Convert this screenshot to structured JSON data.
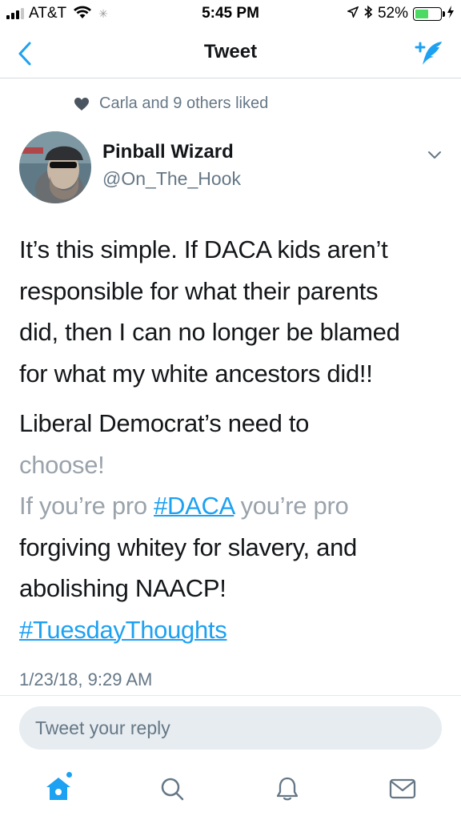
{
  "status_bar": {
    "carrier": "AT&T",
    "time": "5:45 PM",
    "battery_percent": "52%",
    "battery_level": 0.52
  },
  "nav": {
    "title": "Tweet",
    "back_icon": "chevron-left-icon",
    "compose_icon": "compose-tweet-icon"
  },
  "social_context": {
    "text": "Carla and 9 others liked",
    "icon": "heart-icon"
  },
  "author": {
    "name": "Pinball Wizard",
    "handle": "@On_The_Hook"
  },
  "tweet": {
    "lines_p1": [
      "It’s this simple. If DACA kids aren’t",
      "responsible for what their parents",
      "did, then I can no longer be blamed",
      "for what my white ancestors did!!"
    ],
    "p2_line1": "Liberal Democrat’s need to",
    "p2_line2": "choose!",
    "p2_line3_pre": "If you’re pro ",
    "p2_hashtag1": "#DACA",
    "p2_line3_post": " you’re pro",
    "p2_line4": "forgiving whitey for slavery, and",
    "p2_line5": "abolishing NAACP!",
    "p2_hashtag2": "#TuesdayThoughts"
  },
  "timestamp": "1/23/18, 9:29 AM",
  "reply": {
    "placeholder": "Tweet your reply"
  },
  "tabs": [
    {
      "name": "home",
      "icon": "home-icon"
    },
    {
      "name": "search",
      "icon": "search-icon"
    },
    {
      "name": "notifications",
      "icon": "bell-icon"
    },
    {
      "name": "messages",
      "icon": "envelope-icon"
    }
  ],
  "colors": {
    "accent": "#1da1f2",
    "secondary_text": "#657786",
    "primary_text": "#14171a"
  }
}
